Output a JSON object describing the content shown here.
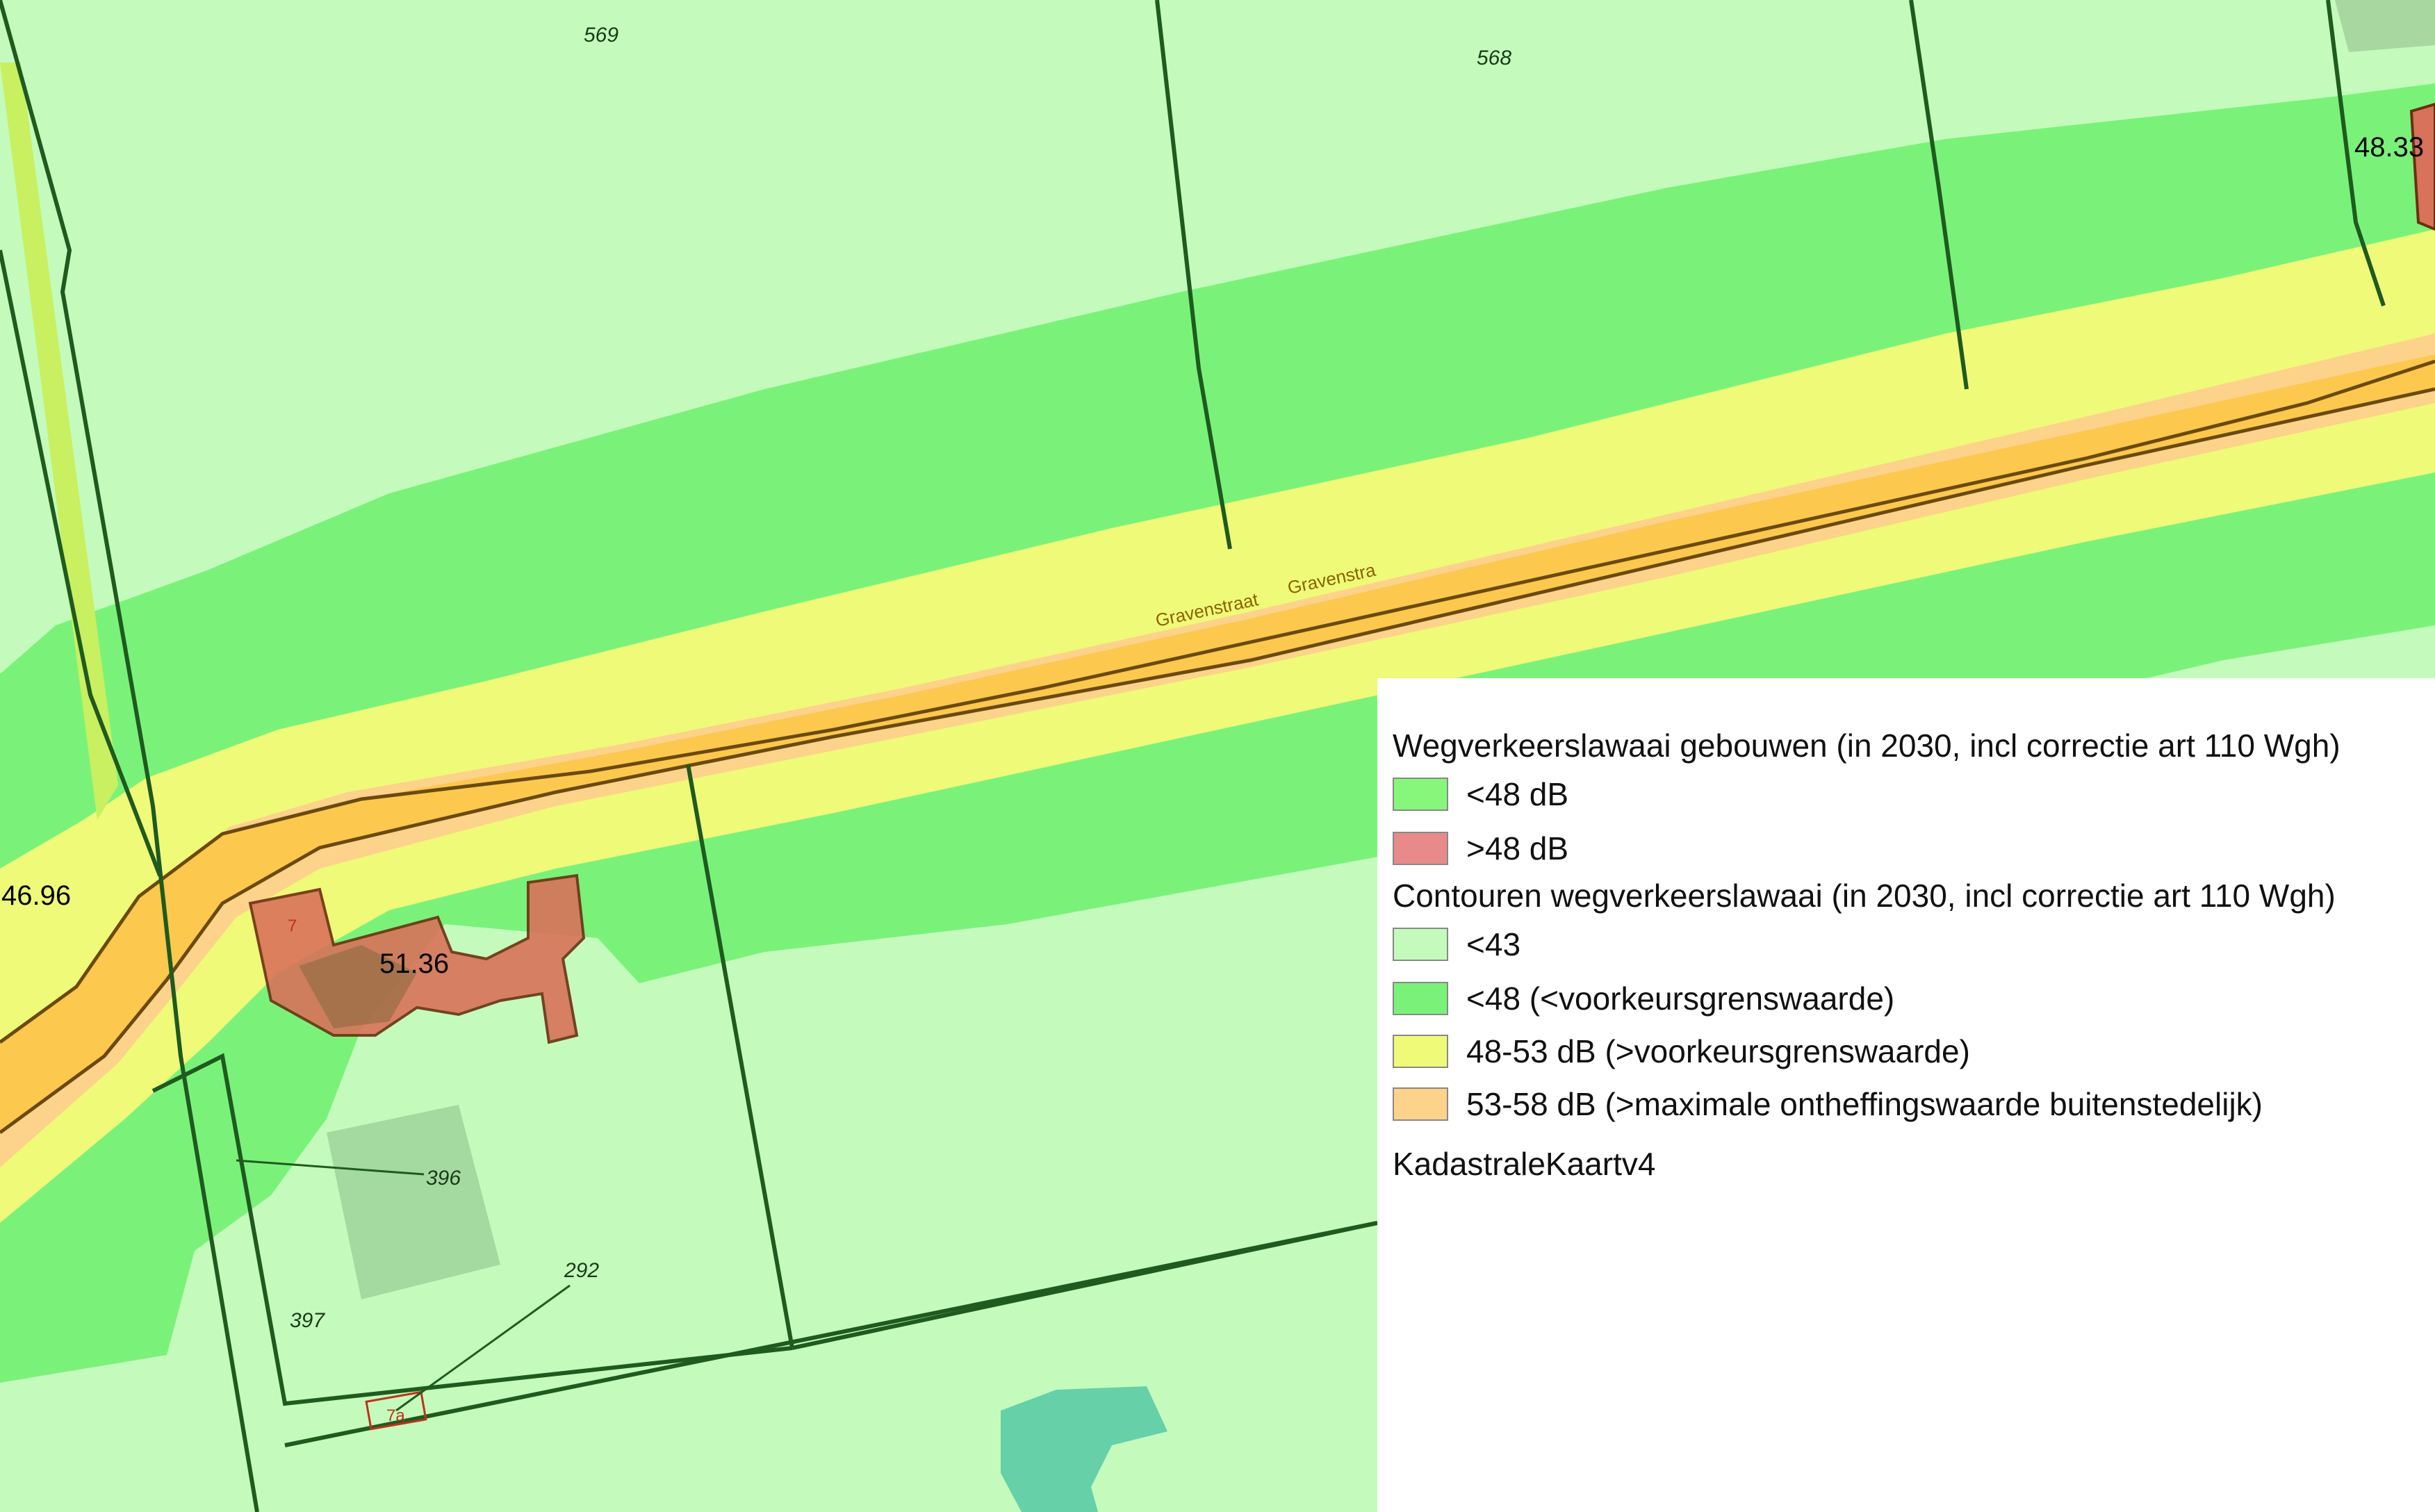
{
  "map": {
    "parcel_labels": {
      "p569": "569",
      "p568": "568",
      "p396": "396",
      "p397": "397",
      "p292": "292"
    },
    "noise_values": {
      "v1": "46.96",
      "v2": "51.36",
      "v3": "48.33"
    },
    "street_labels": [
      "Gravenstraat",
      "Gravenstra"
    ],
    "house_numbers": {
      "h7": "7",
      "h7a": "7a"
    }
  },
  "legend": {
    "section1_title": "Wegverkeerslawaai gebouwen (in 2030, incl correctie art 110 Wgh)",
    "section1_items": [
      {
        "label": "<48 dB",
        "color": "#86f77a"
      },
      {
        "label": ">48 dB",
        "color": "#e88a8a"
      }
    ],
    "section2_title": "Contouren wegverkeerslawaai  (in 2030, incl correctie art 110 Wgh)",
    "section2_items": [
      {
        "label": "<43",
        "color": "#c4fbbc"
      },
      {
        "label": "<48 (<voorkeursgrenswaarde)",
        "color": "#7af27a"
      },
      {
        "label": "48-53 dB (>voorkeursgrenswaarde)",
        "color": "#eefa78"
      },
      {
        "label": "53-58 dB (>maximale ontheffingswaarde buitenstedelijk)",
        "color": "#fdd28a"
      }
    ],
    "section3_title": "KadastraleKaartv4"
  },
  "colors": {
    "contour_lt43": "#c4fbbc",
    "contour_lt48": "#7af27a",
    "contour_48_53": "#eefa78",
    "contour_53_58": "#fdd28a",
    "road": "#fcc84e",
    "building_high": "#d9725a",
    "parcel_line": "#1f5a1f"
  }
}
